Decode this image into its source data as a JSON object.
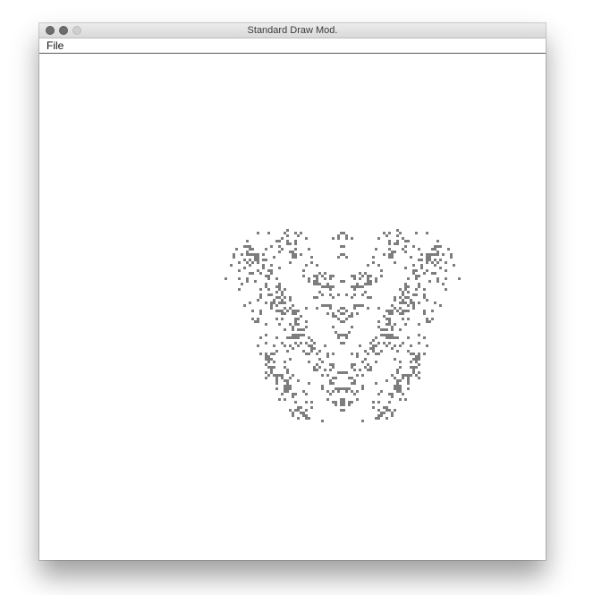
{
  "window": {
    "title": "Standard Draw Mod.",
    "controls": [
      "close",
      "minimize",
      "zoom"
    ]
  },
  "menubar": {
    "items": [
      {
        "label": "File"
      }
    ]
  },
  "canvas": {
    "background_color": "#ffffff",
    "pixel_color": "#7d7d7d",
    "symmetry": "mirror-horizontal"
  }
}
